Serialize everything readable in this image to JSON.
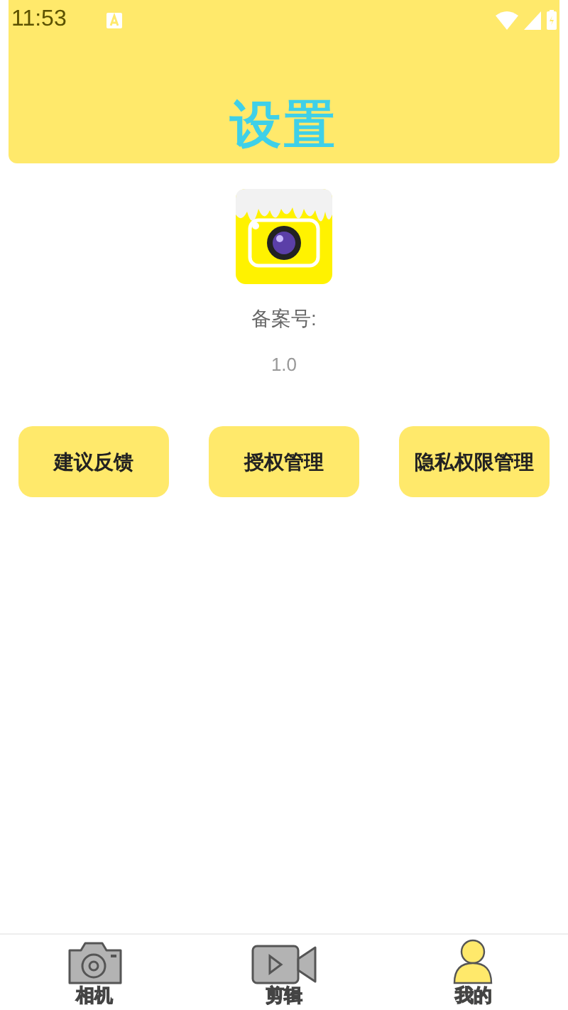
{
  "status_bar": {
    "time": "11:53"
  },
  "header": {
    "title": "设置"
  },
  "app_info": {
    "record_label": "备案号:",
    "version": "1.0"
  },
  "buttons": [
    "建议反馈",
    "授权管理",
    "隐私权限管理"
  ],
  "tabs": [
    {
      "kind": "camera",
      "label": "相机",
      "selected": false
    },
    {
      "kind": "video",
      "label": "剪辑",
      "selected": false
    },
    {
      "kind": "person",
      "label": "我的",
      "selected": true
    }
  ]
}
